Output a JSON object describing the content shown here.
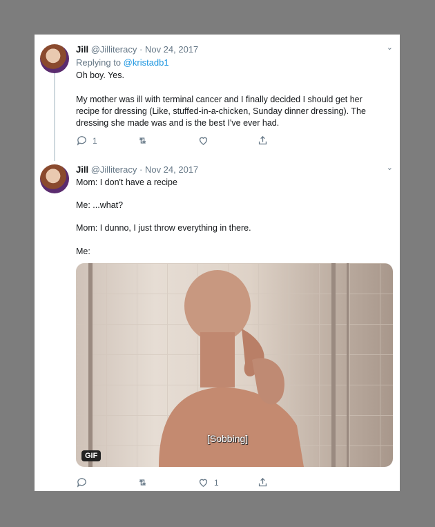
{
  "tweet1": {
    "name": "Jill",
    "handle": "@Jilliteracy",
    "date": "Nov 24, 2017",
    "reply_prefix": "Replying to",
    "reply_to": "@kristadb1",
    "lines": [
      "Oh boy. Yes.",
      "My mother was ill with terminal cancer and I finally decided I should get her",
      "recipe for dressing (Like, stuffed-in-a-chicken, Sunday dinner dressing). The",
      "dressing she made was and is the best I've ever had."
    ],
    "reply_count": "1",
    "like_count": ""
  },
  "tweet2": {
    "name": "Jill",
    "handle": "@Jilliteracy",
    "date": "Nov 24, 2017",
    "lines": [
      "Mom: I don't have a recipe",
      "Me:  ...what?",
      "Mom:  I dunno, I just throw everything in there.",
      "Me:"
    ],
    "gif_caption": "[Sobbing]",
    "gif_badge": "GIF",
    "reply_count": "",
    "like_count": "1"
  },
  "separator": "·",
  "chevron": "⌄",
  "icons": [
    "reply-icon",
    "retweet-icon",
    "like-icon",
    "share-icon",
    "chevron-down-icon"
  ]
}
